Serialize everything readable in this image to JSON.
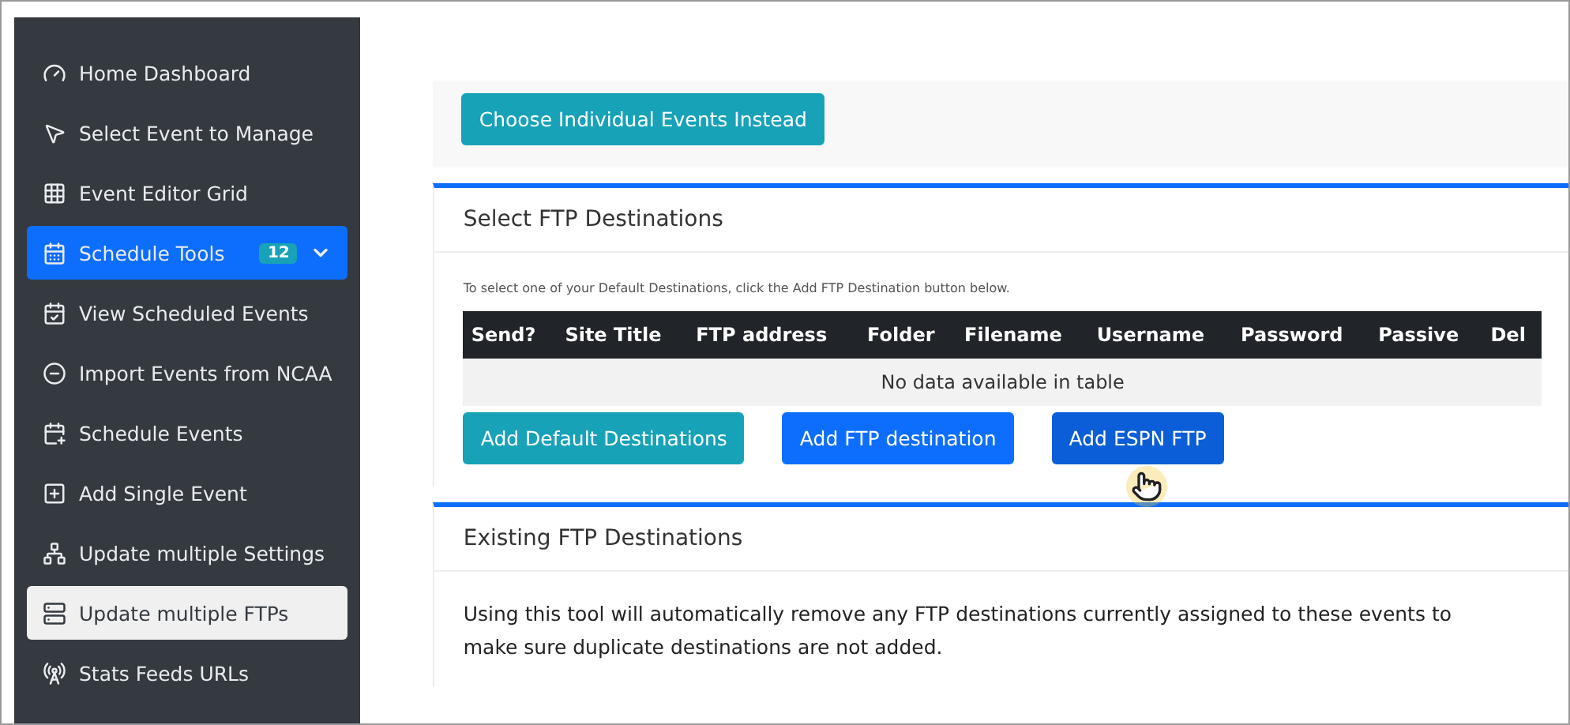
{
  "sidebar": {
    "items": [
      {
        "label": "Home Dashboard",
        "selected": false,
        "expanded": false
      },
      {
        "label": "Select Event to Manage",
        "selected": false,
        "expanded": false
      },
      {
        "label": "Event Editor Grid",
        "selected": false,
        "expanded": false
      },
      {
        "label": "Schedule Tools",
        "badge": "12",
        "selected": false,
        "expanded": true
      },
      {
        "label": "View Scheduled Events",
        "selected": false,
        "expanded": false
      },
      {
        "label": "Import Events from NCAA",
        "selected": false,
        "expanded": false
      },
      {
        "label": "Schedule Events",
        "selected": false,
        "expanded": false
      },
      {
        "label": "Add Single Event",
        "selected": false,
        "expanded": false
      },
      {
        "label": "Update multiple Settings",
        "selected": false,
        "expanded": false
      },
      {
        "label": "Update multiple FTPs",
        "selected": true,
        "expanded": false
      },
      {
        "label": "Stats Feeds URLs",
        "selected": false,
        "expanded": false
      }
    ]
  },
  "choose_panel": {
    "button": "Choose Individual Events Instead"
  },
  "select_panel": {
    "title": "Select FTP Destinations",
    "hint": "To select one of your Default Destinations, click the Add FTP Destination button below.",
    "table": {
      "columns": [
        "Send?",
        "Site Title",
        "FTP address",
        "Folder",
        "Filename",
        "Username",
        "Password",
        "Passive",
        "Del"
      ],
      "empty": "No data available in table"
    },
    "buttons": [
      {
        "label": "Add Default Destinations",
        "color": "#17a2b8"
      },
      {
        "label": "Add FTP destination",
        "color": "#0d6efd"
      },
      {
        "label": "Add ESPN FTP",
        "color": "#0b5ed7"
      }
    ]
  },
  "existing_panel": {
    "title": "Existing FTP Destinations",
    "text": "Using this tool will automatically remove any FTP destinations currently assigned to these events to make sure duplicate destinations are not added."
  }
}
